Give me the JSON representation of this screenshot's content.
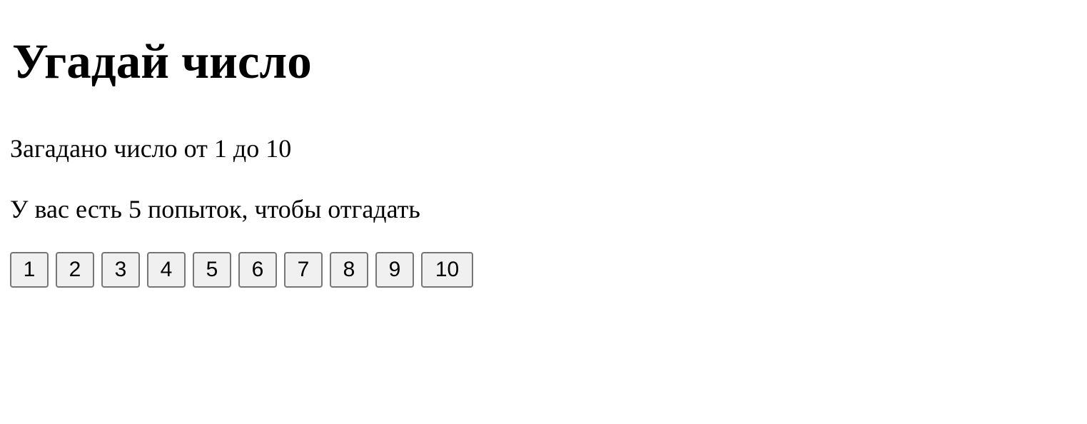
{
  "page": {
    "title": "Угадай число",
    "intro_line": "Загадано число от 1 до 10",
    "attempts_line": "У вас есть 5 попыток, чтобы отгадать"
  },
  "buttons": [
    "1",
    "2",
    "3",
    "4",
    "5",
    "6",
    "7",
    "8",
    "9",
    "10"
  ]
}
